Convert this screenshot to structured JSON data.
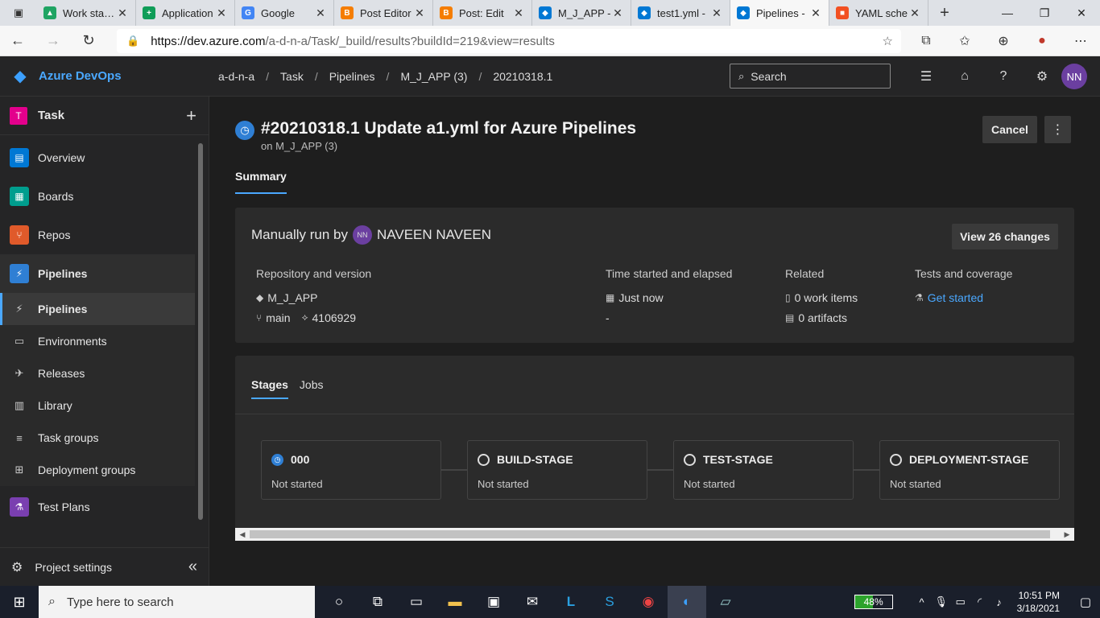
{
  "browser": {
    "tabs": [
      {
        "title": "Work status",
        "icon": "google-drive-icon",
        "color": "#1fa463",
        "glyph": "▲"
      },
      {
        "title": "Application",
        "icon": "google-sheets-icon",
        "color": "#0f9d58",
        "glyph": "+"
      },
      {
        "title": "Google",
        "icon": "google-icon",
        "color": "#4285f4",
        "glyph": "G"
      },
      {
        "title": "Post Editor",
        "icon": "blogger-icon",
        "color": "#f57d00",
        "glyph": "B"
      },
      {
        "title": "Post: Edit",
        "icon": "blogger-icon",
        "color": "#f57d00",
        "glyph": "B"
      },
      {
        "title": "M_J_APP -",
        "icon": "azure-devops-icon",
        "color": "#0078d4",
        "glyph": "◆"
      },
      {
        "title": "test1.yml -",
        "icon": "azure-devops-icon",
        "color": "#0078d4",
        "glyph": "◆"
      },
      {
        "title": "Pipelines -",
        "icon": "azure-devops-icon",
        "color": "#0078d4",
        "glyph": "◆",
        "active": true
      },
      {
        "title": "YAML sche",
        "icon": "microsoft-icon",
        "color": "#f25022",
        "glyph": "■"
      }
    ],
    "url_host": "https://dev.azure.com",
    "url_path": "/a-d-n-a/Task/_build/results?buildId=219&view=results"
  },
  "header": {
    "brand": "Azure DevOps",
    "breadcrumb": [
      "a-d-n-a",
      "Task",
      "Pipelines",
      "M_J_APP (3)",
      "20210318.1"
    ],
    "search_placeholder": "Search",
    "avatar_initials": "NN"
  },
  "sidebar": {
    "project_initial": "T",
    "project_name": "Task",
    "items": [
      {
        "label": "Overview",
        "icon": "overview-icon",
        "color": "#0078d4",
        "glyph": "▤"
      },
      {
        "label": "Boards",
        "icon": "boards-icon",
        "color": "#009e8e",
        "glyph": "▦"
      },
      {
        "label": "Repos",
        "icon": "repos-icon",
        "color": "#e05a2a",
        "glyph": "⑂"
      },
      {
        "label": "Pipelines",
        "icon": "pipelines-icon",
        "color": "#2f7fd4",
        "glyph": "⚡"
      }
    ],
    "subitems": [
      {
        "label": "Pipelines",
        "icon": "pipelines-sub-icon",
        "glyph": "⚡",
        "selected": true
      },
      {
        "label": "Environments",
        "icon": "environments-icon",
        "glyph": "▭"
      },
      {
        "label": "Releases",
        "icon": "releases-icon",
        "glyph": "✈"
      },
      {
        "label": "Library",
        "icon": "library-icon",
        "glyph": "▥"
      },
      {
        "label": "Task groups",
        "icon": "task-groups-icon",
        "glyph": "≡"
      },
      {
        "label": "Deployment groups",
        "icon": "deployment-groups-icon",
        "glyph": "⊞"
      }
    ],
    "test_plans": {
      "label": "Test Plans",
      "icon": "test-plans-icon",
      "color": "#7a3fb0",
      "glyph": "⚗"
    },
    "project_settings": "Project settings"
  },
  "run": {
    "title": "#20210318.1 Update a1.yml for Azure Pipelines",
    "subtitle": "on M_J_APP (3)",
    "cancel": "Cancel",
    "more": "⋮",
    "tab_summary": "Summary",
    "manual_prefix": "Manually run by",
    "user_initials": "NN",
    "user_name": "NAVEEN NAVEEN",
    "view_changes": "View 26 changes",
    "repo_label": "Repository and version",
    "repo_name": "M_J_APP",
    "branch": "main",
    "commit": "4106929",
    "time_label": "Time started and elapsed",
    "time_started": "Just now",
    "time_elapsed": "-",
    "related_label": "Related",
    "work_items": "0 work items",
    "artifacts": "0 artifacts",
    "tests_label": "Tests and coverage",
    "tests_link": "Get started"
  },
  "stages_panel": {
    "tabs": [
      "Stages",
      "Jobs"
    ],
    "stages": [
      {
        "name": "000",
        "status": "Not started",
        "icon": "in-progress-clock-icon"
      },
      {
        "name": "BUILD-STAGE",
        "status": "Not started",
        "icon": "not-started-circle-icon"
      },
      {
        "name": "TEST-STAGE",
        "status": "Not started",
        "icon": "not-started-circle-icon"
      },
      {
        "name": "DEPLOYMENT-STAGE",
        "status": "Not started",
        "icon": "not-started-circle-icon"
      }
    ]
  },
  "taskbar": {
    "search_placeholder": "Type here to search",
    "battery": "48%",
    "battery_level": 0.48,
    "time": "10:51 PM",
    "date": "3/18/2021"
  }
}
